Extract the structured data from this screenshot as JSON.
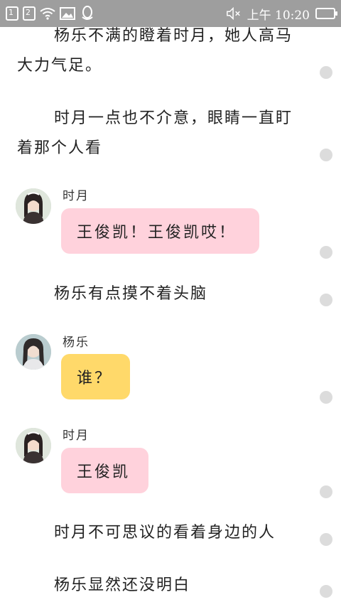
{
  "status_bar": {
    "sim1": "1",
    "sim2": "2",
    "time": "上午 10:20"
  },
  "story": [
    {
      "type": "para",
      "text": "杨乐不满的瞪着时月，她人高马大力气足。"
    },
    {
      "type": "para",
      "text": "时月一点也不介意，眼睛一直盯着那个人看"
    },
    {
      "type": "chat",
      "speaker": "时月",
      "text": "王俊凯！王俊凯哎！",
      "bubble_color": "#ffd2dc"
    },
    {
      "type": "para",
      "text": "杨乐有点摸不着头脑"
    },
    {
      "type": "chat",
      "speaker": "杨乐",
      "text": "谁？",
      "bubble_color": "#ffd96a"
    },
    {
      "type": "chat",
      "speaker": "时月",
      "text": "王俊凯",
      "bubble_color": "#ffd2dc"
    },
    {
      "type": "para",
      "text": "时月不可思议的看着身边的人"
    },
    {
      "type": "para",
      "text": "杨乐显然还没明白"
    }
  ],
  "icons": {
    "sim1": "sim-card-1-icon",
    "sim2": "sim-card-2-icon",
    "wifi": "wifi-icon",
    "image": "image-notification-icon",
    "qq": "qq-icon",
    "mute": "mute-icon",
    "battery": "battery-icon",
    "comment_dot": "comment-dot-icon"
  }
}
